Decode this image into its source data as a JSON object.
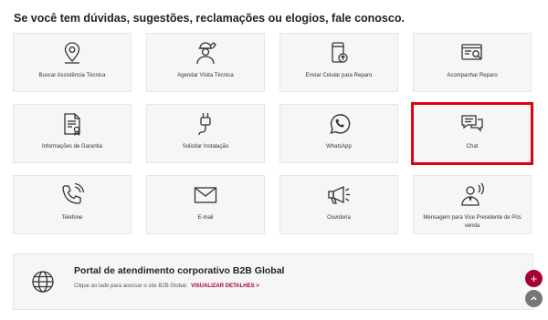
{
  "heading": "Se você tem dúvidas, sugestões, reclamações ou elogios, fale conosco.",
  "cards": [
    {
      "label": "Buscar Assistência Técnica",
      "icon": "map-pin-icon"
    },
    {
      "label": "Agendar Visita Técnica",
      "icon": "technician-icon"
    },
    {
      "label": "Enviar Celular para Reparo",
      "icon": "phone-upload-icon"
    },
    {
      "label": "Acompanhar Reparo",
      "icon": "tracking-icon"
    },
    {
      "label": "Informações de Garantia",
      "icon": "warranty-document-icon"
    },
    {
      "label": "Solicitar Instalação",
      "icon": "plug-icon"
    },
    {
      "label": "WhatsApp",
      "icon": "whatsapp-icon"
    },
    {
      "label": "Chat",
      "icon": "chat-icon"
    },
    {
      "label": "Telefone",
      "icon": "phone-icon"
    },
    {
      "label": "E-mail",
      "icon": "mail-icon"
    },
    {
      "label": "Ouvidoria",
      "icon": "megaphone-icon"
    },
    {
      "label": "Mensagem para Vice Presidente de Pós venda",
      "icon": "executive-icon"
    }
  ],
  "portal": {
    "title": "Portal de atendimento corporativo B2B Global",
    "description": "Clique ao lado para acessar o site B2B Global.",
    "link": "VISUALIZAR DETALHES",
    "link_arrow": ">"
  },
  "floating": {
    "add_symbol": "+",
    "top_symbol": "^"
  },
  "colors": {
    "accent": "#a50034",
    "highlight": "#e3000f",
    "card_bg": "#f6f6f6"
  }
}
